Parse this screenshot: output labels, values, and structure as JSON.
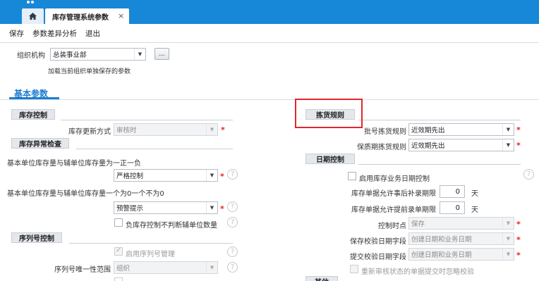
{
  "tabs": {
    "home_icon": "home-icon",
    "active_tab": "库存管理系统参数",
    "close_glyph": "×"
  },
  "toolbar": {
    "save": "保存",
    "diff": "参数差异分析",
    "exit": "退出"
  },
  "org": {
    "label": "组织机构",
    "value": "总装事业部",
    "ellipsis": "...",
    "hint": "加载当前组织单独保存的参数"
  },
  "section": {
    "title": "基本参数"
  },
  "inventory_control": {
    "header": "库存控制",
    "update_mode_label": "库存更新方式",
    "update_mode_value": "审核时"
  },
  "inventory_exception": {
    "header": "库存异常检查",
    "rule1_label": "基本单位库存量与辅单位库存量为一正一负",
    "rule1_value": "严格控制",
    "rule2_label": "基本单位库存量与辅单位库存量一个为0一个不为0",
    "rule2_value": "预警提示",
    "neg_check_label": "负库存控制不判断辅单位数量"
  },
  "serial_control": {
    "header": "序列号控制",
    "enable_label": "启用序列号管理",
    "scope_label": "序列号唯一性范围",
    "scope_value": "组织"
  },
  "picking_rules": {
    "header": "拣货规则",
    "batch_label": "批号拣货规则",
    "batch_value": "近效期先出",
    "shelf_label": "保质期拣货规则",
    "shelf_value": "近效期先出"
  },
  "date_control": {
    "header": "日期控制",
    "enable_label": "启用库存业务日期控制",
    "after_label": "库存单据允许事后补录期限",
    "after_value": "0",
    "after_unit": "天",
    "before_label": "库存单据允许提前录单期限",
    "before_value": "0",
    "before_unit": "天",
    "timing_label": "控制时点",
    "timing_value": "保存",
    "save_field_label": "保存校验日期字段",
    "save_field_value": "创建日期和业务日期",
    "submit_field_label": "提交校验日期字段",
    "submit_field_value": "创建日期和业务日期",
    "reaudit_label": "重新审核状态的单据提交时忽略校验"
  },
  "other": {
    "header": "其他"
  },
  "colors": {
    "topbar": "#1787d8",
    "accent": "#1d7ed2",
    "highlight": "#e3262c",
    "required": "#e02020"
  }
}
